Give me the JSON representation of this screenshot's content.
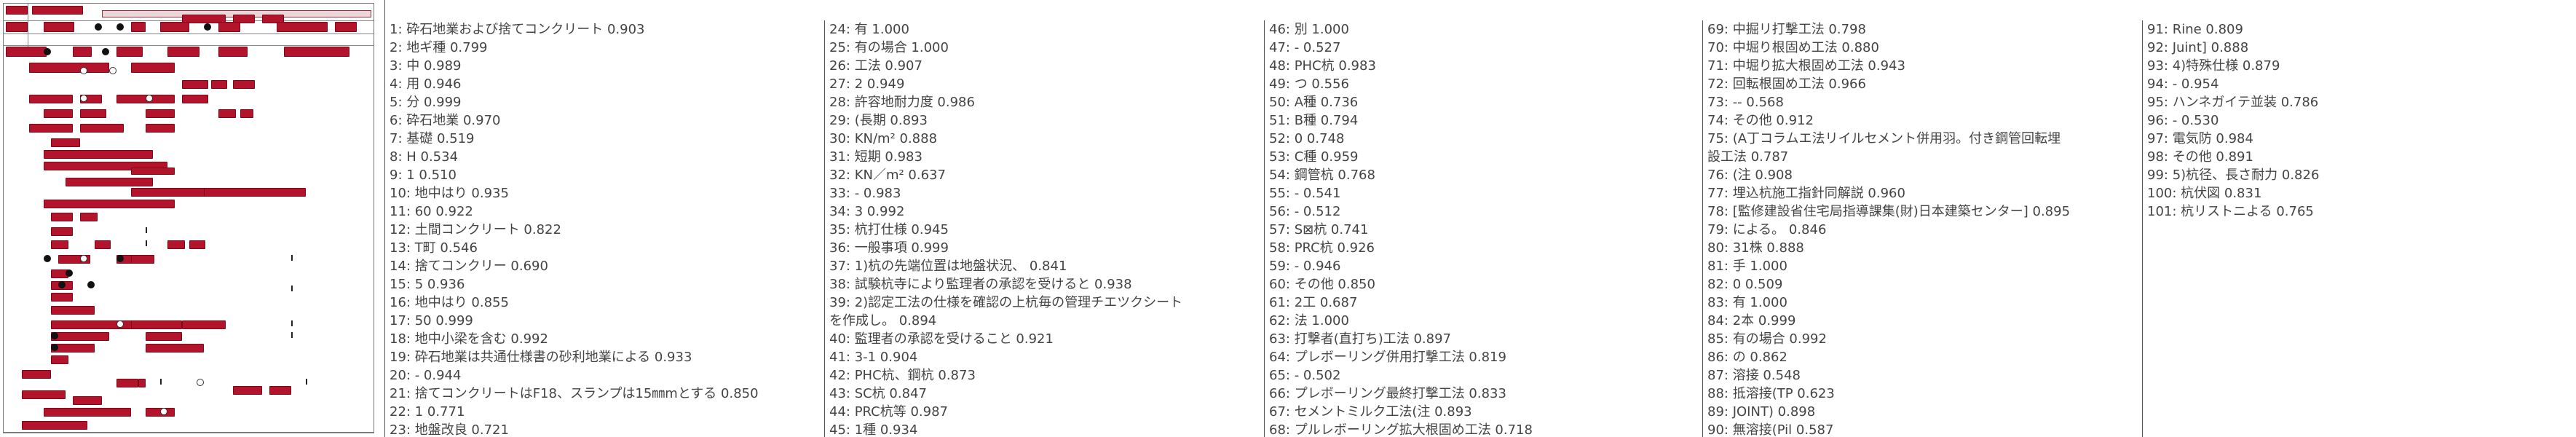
{
  "columns": [
    [
      "1: 砕石地業および捨てコンクリート  0.903",
      "2: 地ギ種  0.799",
      "3: 中  0.989",
      "4: 用  0.946",
      "5: 分  0.999",
      "6: 砕石地業  0.970",
      "7: 基礎  0.519",
      "8: H  0.534",
      "9: 1  0.510",
      "10: 地中はり  0.935",
      "11: 60  0.922",
      "12: 土間コンクリート  0.822",
      "13: T町  0.546",
      "14: 捨てコンクリー  0.690",
      "15: 5  0.936",
      "16: 地中はり  0.855",
      "17: 50  0.999",
      "18: 地中小梁を含む  0.992",
      "19: 砕石地業は共通仕様書の砂利地業による  0.933",
      "20: -  0.944",
      "21: 捨てコンクリートはF18、スランプは15㎜mとする  0.850",
      "22: 1  0.771",
      "23: 地盤改良  0.721"
    ],
    [
      "24: 有  1.000",
      "25: 有の場合  1.000",
      "26: 工法  0.907",
      "27: 2  0.949",
      "28: 許容地耐力度  0.986",
      "29: (長期  0.893",
      "30: KN/m²  0.888",
      "31: 短期  0.983",
      "32: KN／m²  0.637",
      "33: -  0.983",
      "34: 3  0.992",
      "35: 杭打仕様  0.945",
      "36: 一般事項  0.999",
      "37: 1)杭の先端位置は地盤状況、  0.841",
      "38: 試験杭寺により監理者の承認を受けると  0.938",
      "39: 2)認定工法の仕様を確認の上杭毎の管理チエツクシート",
      "を作成し。  0.894",
      "40: 監理者の承認を受けること  0.921",
      "41: 3-1  0.904",
      "42: PHC杭、鋼杭  0.873",
      "43: SC杭  0.847",
      "44: PRC杭等  0.987",
      "45: 1種  0.934"
    ],
    [
      "46: 別  1.000",
      "47: -  0.527",
      "48: PHC杭  0.983",
      "49: つ  0.556",
      "50: A種  0.736",
      "51: B種  0.794",
      "52: 0  0.748",
      "53: C種  0.959",
      "54: 鋼管杭  0.768",
      "55: -  0.541",
      "56: -  0.512",
      "57: S⊠杭  0.741",
      "58: PRC杭  0.926",
      "59: -  0.946",
      "60: その他  0.850",
      "61: 2工  0.687",
      "62: 法  1.000",
      "63: 打撃者(直打ち)工法  0.897",
      "64: プレボーリング併用打撃工法  0.819",
      "65: -  0.502",
      "66: プレボーリング最終打撃工法  0.833",
      "67: セメントミルク工法(注  0.893",
      "68: プルレボーリング拡大根固め工法  0.718"
    ],
    [
      "69: 中掘リ打撃工法  0.798",
      "70: 中堀り根固め工法  0.880",
      "71: 中堀り拡大根固め工法  0.943",
      "72: 回転根固め工法  0.966",
      "73: --  0.568",
      "74: その他  0.912",
      "75: (A丁コラムエ法リイルセメント併用羽。付き鋼管回転埋",
      "設工法  0.787",
      "76: (注  0.908",
      "77: 埋込杭施工指針同解説  0.960",
      "78: [監修建設省住宅局指導課集(財)日本建築センター]  0.895",
      "79: による。  0.846",
      "80: 31株  0.888",
      "81: 手  1.000",
      "82: 0  0.509",
      "83: 有  1.000",
      "84: 2本  0.999",
      "85: 有の場合  0.992",
      "86: の  0.862",
      "87: 溶接  0.548",
      "88: 抵溶接(TP  0.623",
      "89: JOINT)  0.898",
      "90: 無溶接(Pil  0.587"
    ],
    [
      "91: Rine  0.809",
      "92: Juint]  0.888",
      "93: 4)特殊仕様  0.879",
      "94: -  0.954",
      "95: ハンネガイテ並装  0.786",
      "96: -  0.530",
      "97: 電気防  0.984",
      "98: その他  0.891",
      "99: 5)杭径、長さ耐力  0.826",
      "100: 杭伏図  0.831",
      "101: 杭リストニよる  0.765"
    ]
  ],
  "colors": {
    "box": "#b3132b",
    "text": "#444444",
    "divider": "#555555"
  }
}
